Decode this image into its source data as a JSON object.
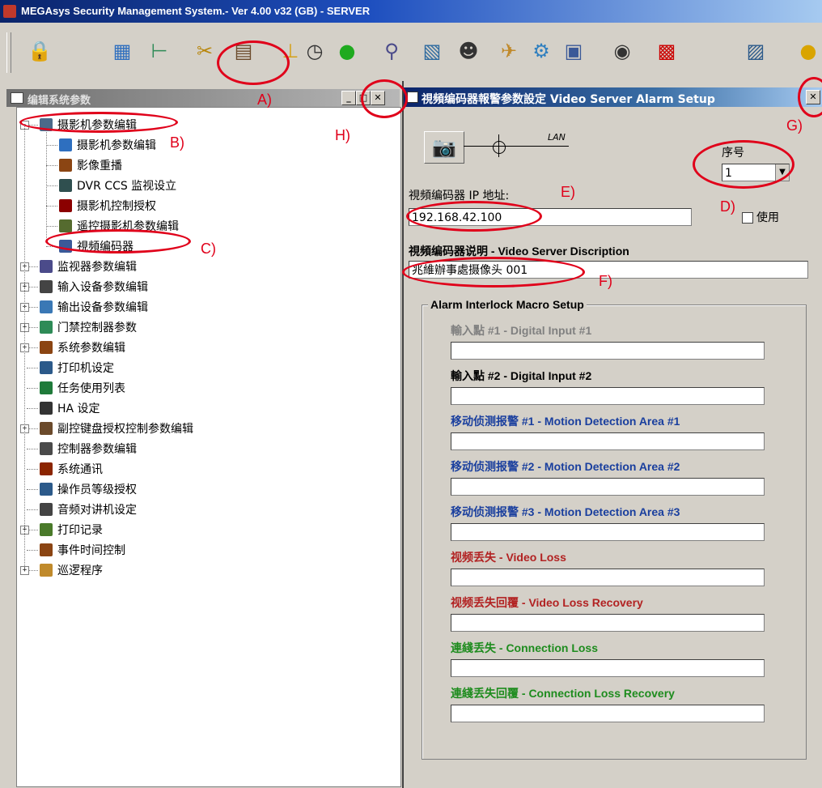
{
  "window": {
    "title": "MEGAsys Security Management System.- Ver 4.00 v32 (GB) - SERVER"
  },
  "toolbar": {
    "icons": [
      "lock-icon",
      "network-icon",
      "tree-icon",
      "tools-icon",
      "cabinet-icon",
      "signal-icon",
      "clock-icon",
      "status-light-icon",
      "search-person-icon",
      "document-icon",
      "agent-icon",
      "satellite-icon",
      "settings-icon",
      "video-icon",
      "monitor-icon",
      "color-grid-icon",
      "export-icon",
      "coin-icon"
    ]
  },
  "left_panel": {
    "title": "编辑系统参数",
    "tree": [
      {
        "label": "摄影机参数编辑",
        "level": 0,
        "expander": "-"
      },
      {
        "label": "摄影机参数编辑",
        "level": 1
      },
      {
        "label": "影像重播",
        "level": 1
      },
      {
        "label": "DVR CCS 监视设立",
        "level": 1
      },
      {
        "label": "摄影机控制授权",
        "level": 1
      },
      {
        "label": "遥控摄影机参数编辑",
        "level": 1
      },
      {
        "label": "視頻编码器",
        "level": 1
      },
      {
        "label": "监视器参数编辑",
        "level": 0,
        "expander": "+"
      },
      {
        "label": "输入设备参数编辑",
        "level": 0,
        "expander": "+"
      },
      {
        "label": "输出设备参数编辑",
        "level": 0,
        "expander": "+"
      },
      {
        "label": "门禁控制器参数",
        "level": 0,
        "expander": "+"
      },
      {
        "label": "系统参数编辑",
        "level": 0,
        "expander": "+"
      },
      {
        "label": "打印机设定",
        "level": 0
      },
      {
        "label": "任务使用列表",
        "level": 0
      },
      {
        "label": "HA 设定",
        "level": 0
      },
      {
        "label": "副控键盘授权控制参数编辑",
        "level": 0,
        "expander": "+"
      },
      {
        "label": "控制器参数编辑",
        "level": 0
      },
      {
        "label": "系统通讯",
        "level": 0
      },
      {
        "label": "操作员等级授权",
        "level": 0
      },
      {
        "label": "音频对讲机设定",
        "level": 0
      },
      {
        "label": "打印记录",
        "level": 0,
        "expander": "+"
      },
      {
        "label": "事件时间控制",
        "level": 0
      },
      {
        "label": "巡逻程序",
        "level": 0,
        "expander": "+"
      }
    ]
  },
  "right_panel": {
    "title": "視頻编码器報警参数設定 Video Server Alarm Setup",
    "lan_label": "LAN",
    "serial_label": "序号",
    "serial_value": "1",
    "ip_label": "視頻编码器 IP 地址:",
    "ip_value": "192.168.42.100",
    "use_label": "使用",
    "desc_label": "視頻编码器说明 - Video Server Discription",
    "desc_value": "兆維辦事處摄像头 001",
    "group_title": "Alarm Interlock Macro Setup",
    "inputs": [
      {
        "label": "輸入點 #1 - Digital Input #1",
        "color": "#808080",
        "value": ""
      },
      {
        "label": "輸入點 #2 - Digital Input #2",
        "color": "#000000",
        "value": ""
      },
      {
        "label": "移动侦测报警 #1 - Motion Detection Area #1",
        "color": "#1a3f9e",
        "value": ""
      },
      {
        "label": "移动侦测报警 #2 - Motion Detection Area #2",
        "color": "#1a3f9e",
        "value": ""
      },
      {
        "label": "移动侦测报警 #3 - Motion Detection Area #3",
        "color": "#1a3f9e",
        "value": ""
      },
      {
        "label": "视频丢失 - Video Loss",
        "color": "#b22222",
        "value": ""
      },
      {
        "label": "视频丢失回覆  - Video Loss Recovery",
        "color": "#b22222",
        "value": ""
      },
      {
        "label": "連綫丢失 - Connection Loss",
        "color": "#1e8c1e",
        "value": ""
      },
      {
        "label": "連綫丢失回覆 - Connection Loss Recovery",
        "color": "#1e8c1e",
        "value": ""
      }
    ]
  },
  "annotations": {
    "a": "A)",
    "b": "B)",
    "c": "C)",
    "d": "D)",
    "e": "E)",
    "f": "F)",
    "g": "G)",
    "h": "H)"
  }
}
